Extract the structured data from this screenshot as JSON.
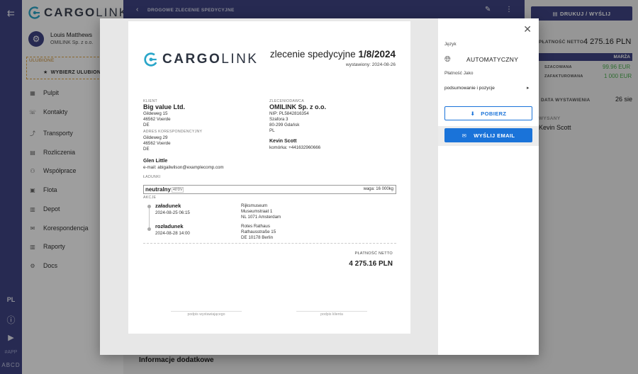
{
  "app": {
    "brand_prefix": "CARGO",
    "brand_suffix": "LINK"
  },
  "rail": {
    "language": "PL",
    "app_tag": "#APP",
    "app_code": "ABCD"
  },
  "user": {
    "name": "Louis Matthews",
    "company": "OMILINK Sp. z o.o."
  },
  "favorites": {
    "label": "ULUBIONE",
    "button": "WYBIERZ ULUBIONE"
  },
  "nav": [
    {
      "label": "Pulpit",
      "icon": "dashboard-icon"
    },
    {
      "label": "Kontakty",
      "icon": "contacts-icon"
    },
    {
      "label": "Transporty",
      "icon": "transport-icon"
    },
    {
      "label": "Rozliczenia",
      "icon": "billing-icon"
    },
    {
      "label": "Współprace",
      "icon": "cooperation-icon"
    },
    {
      "label": "Flota",
      "icon": "fleet-icon"
    },
    {
      "label": "Depot",
      "icon": "depot-icon"
    },
    {
      "label": "Korespondencja",
      "icon": "mail-icon"
    },
    {
      "label": "Raporty",
      "icon": "reports-icon"
    },
    {
      "label": "Docs",
      "icon": "docs-icon"
    }
  ],
  "header": {
    "title": "DROGOWE ZLECENIE SPEDYCYJNE",
    "print_button": "DRUKUJ / WYŚLIJ"
  },
  "right_panel": {
    "net_label": "PŁATNOŚĆ NETTO",
    "net_value": "4 275.16 PLN",
    "margin_label": "MARŻA",
    "estimated_label": "SZACOWANA",
    "estimated_value": "99.96 EUR",
    "invoiced_label": "ZAFAKTUROWANA",
    "invoiced_value": "1 000 EUR",
    "issue_label": "DATA WYSTAWIENIA",
    "issue_value": "26 sie",
    "issuer_label": "WYSANY",
    "issuer_value": "Kevin Scott"
  },
  "bottom": {
    "additional_info": "Informacje dodatkowe"
  },
  "document": {
    "title": "zlecenie spedycyjne",
    "number": "1/8/2024",
    "issued": "wystawiony: 2024-08-26",
    "client_label": "KLIENT",
    "client_name": "Big value Ltd.",
    "client_street": "Gildeweg 15",
    "client_city": "46562 Voerde",
    "client_country": "DE",
    "corr_label": "ADRES KORESPONDENCYJNY",
    "corr_street": "Gildeweg 29",
    "corr_city": "46562 Voerde",
    "corr_country": "DE",
    "orderer_label": "ZLECENIODAWCA",
    "orderer_name": "OMILINK Sp. z o.o.",
    "orderer_nip": "NIP: PL5842816354",
    "orderer_street": "Szafora 3",
    "orderer_city": "80-299 Gdańsk",
    "orderer_country": "PL",
    "contact_name": "Kevin Scott",
    "contact_phone": "komórka: +441632960666",
    "person_name": "Glen Little",
    "person_email": "e-mail: abigailwilson@examplecomp.com",
    "cargo_label": "ŁADUNKI",
    "cargo_name": "neutralny",
    "cargo_tag": "40'DV",
    "cargo_weight": "waga: 16 000kg",
    "actions_label": "AKCJE",
    "load_label": "załadunek",
    "load_date": "2024-08-25 06:15",
    "load_place": "Rijksmuseum",
    "load_street": "Museumstraat 1",
    "load_city": "NL 1071 Amsterdam",
    "unload_label": "rozładunek",
    "unload_date": "2024-08-28 14:00",
    "unload_place": "Rotes Rathaus",
    "unload_street": "Rathausstraße 15",
    "unload_city": "DE 10178 Berlin",
    "net_label": "PŁATNOŚĆ NETTO",
    "net_value": "4 275.16 PLN",
    "sig_issuer": "podpis wystawiającego",
    "sig_carrier": "podpis klienta"
  },
  "options": {
    "language_label": "Język",
    "language_value": "AUTOMATYCZNY",
    "payment_label": "Płatność Jako",
    "payment_value": "podsumowanie i pozycje",
    "download_button": "POBIERZ",
    "send_button": "WYŚLIJ EMAIL"
  },
  "colors": {
    "primary": "#3f4585",
    "accent": "#1a73d9",
    "green": "#4caf50"
  }
}
